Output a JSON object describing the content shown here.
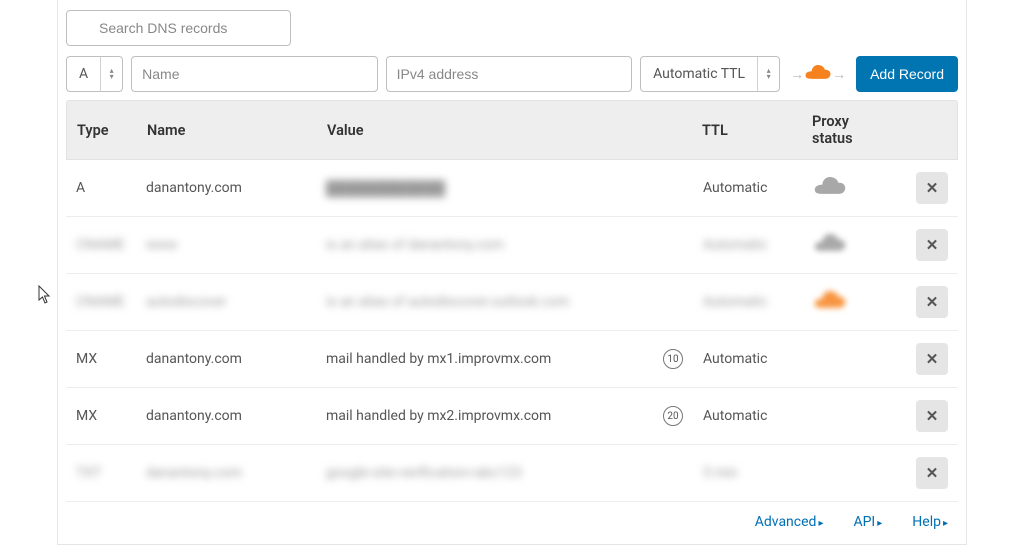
{
  "search": {
    "placeholder": "Search DNS records"
  },
  "addRow": {
    "typeLabel": "A",
    "namePlaceholder": "Name",
    "valuePlaceholder": "IPv4 address",
    "ttlLabel": "Automatic TTL",
    "addButton": "Add Record"
  },
  "columns": {
    "type": "Type",
    "name": "Name",
    "value": "Value",
    "ttl": "TTL",
    "proxy": "Proxy status"
  },
  "rows": [
    {
      "type": "A",
      "name": "danantony.com",
      "value": "████████████",
      "valueBlur": true,
      "ttl": "Automatic",
      "proxy": "gray",
      "blurred": false
    },
    {
      "type": "CNAME",
      "name": "www",
      "value": "is an alias of danantony.com",
      "valueBlur": true,
      "ttl": "Automatic",
      "proxy": "gray-blur",
      "blurred": true
    },
    {
      "type": "CNAME",
      "name": "autodiscover",
      "value": "is an alias of autodiscover.outlook.com",
      "valueBlur": true,
      "ttl": "Automatic",
      "proxy": "orange-blur",
      "blurred": true
    },
    {
      "type": "MX",
      "name": "danantony.com",
      "value": "mail handled by mx1.improvmx.com",
      "valueBlur": false,
      "priority": "10",
      "ttl": "Automatic",
      "proxy": "none",
      "blurred": false
    },
    {
      "type": "MX",
      "name": "danantony.com",
      "value": "mail handled by mx2.improvmx.com",
      "valueBlur": false,
      "priority": "20",
      "ttl": "Automatic",
      "proxy": "none",
      "blurred": false
    },
    {
      "type": "TXT",
      "name": "danantony.com",
      "value": "google-site-verification=abc123",
      "valueBlur": true,
      "ttl": "5 min",
      "proxy": "none",
      "blurred": true
    }
  ],
  "footer": {
    "advanced": "Advanced",
    "api": "API",
    "help": "Help"
  }
}
